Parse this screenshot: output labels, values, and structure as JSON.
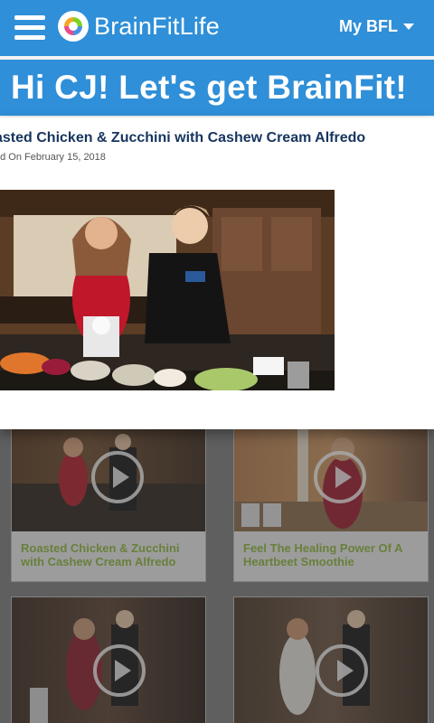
{
  "header": {
    "logo_text": "BrainFitLife",
    "menu_label": "My BFL"
  },
  "banner": {
    "greeting": "Hi CJ! Let's get BrainFit!"
  },
  "modal": {
    "title": "asted Chicken & Zucchini with Cashew Cream Alfredo",
    "date": "ed On February 15, 2018"
  },
  "videos": [
    {
      "title": "Roasted Chicken & Zucchini with Cashew Cream Alfredo"
    },
    {
      "title": "Feel The Healing Power Of A Heartbeet Smoothie"
    },
    {
      "title": ""
    },
    {
      "title": ""
    }
  ],
  "colors": {
    "brand_blue": "#2f8fd8",
    "title_navy": "#16355e",
    "card_title_green": "#8db83b"
  }
}
